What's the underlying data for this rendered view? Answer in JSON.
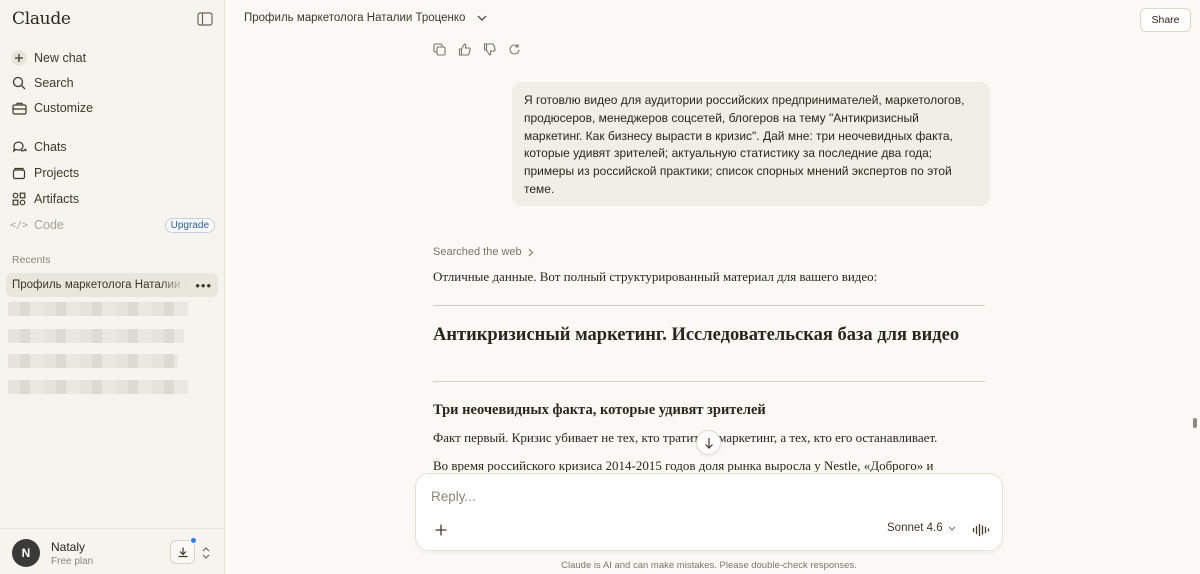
{
  "sidebar": {
    "brand": "Claude",
    "nav": [
      {
        "label": "New chat",
        "icon": "plus-icon"
      },
      {
        "label": "Search",
        "icon": "search-icon"
      },
      {
        "label": "Customize",
        "icon": "briefcase-icon"
      },
      {
        "label": "Chats",
        "icon": "chat-bubbles-icon"
      },
      {
        "label": "Projects",
        "icon": "folder-icon"
      },
      {
        "label": "Artifacts",
        "icon": "grid-icon"
      },
      {
        "label": "Code",
        "icon": "code-icon",
        "badge": "Upgrade"
      }
    ],
    "recents_label": "Recents",
    "recents_active": "Профиль маркетолога Наталии Троценко",
    "user": {
      "initial": "N",
      "name": "Nataly",
      "plan": "Free plan"
    }
  },
  "header": {
    "title": "Профиль маркетолога Наталии Троценко",
    "share_label": "Share"
  },
  "conversation": {
    "user_message": "Я готовлю видео для аудитории российских предпринимателей, маркетологов, продюсеров, менеджеров соцсетей, блогеров на тему \"Антикризисный маркетинг. Как бизнесу вырасти в кризис\". Дай мне: три неочевидных факта, которые удивят зрителей; актуальную статистику за последние два года; примеры из российской практики; список спорных мнений экспертов по этой теме.",
    "searched_label": "Searched the web",
    "intro": "Отличные данные. Вот полный структурированный материал для вашего видео:",
    "heading": "Антикризисный маркетинг. Исследовательская база для видео",
    "subheading": "Три неочевидных факта, которые удивят зрителей",
    "paragraph1": "Факт первый. Кризис убивает не тех, кто тратит на маркетинг, а тех, кто его останавливает.",
    "paragraph2": "Во время российского кризиса 2014-2015 годов доля рынка выросла у Nestle, «Доброго» и"
  },
  "composer": {
    "placeholder": "Reply...",
    "model": "Sonnet 4.6"
  },
  "disclaimer": "Claude is AI and can make mistakes. Please double-check responses.",
  "colors": {
    "accent_blue": "#2c7be5",
    "upgrade_text": "#2c5fa0",
    "background": "#faf9f5",
    "sidebar": "#f5f4ef"
  }
}
